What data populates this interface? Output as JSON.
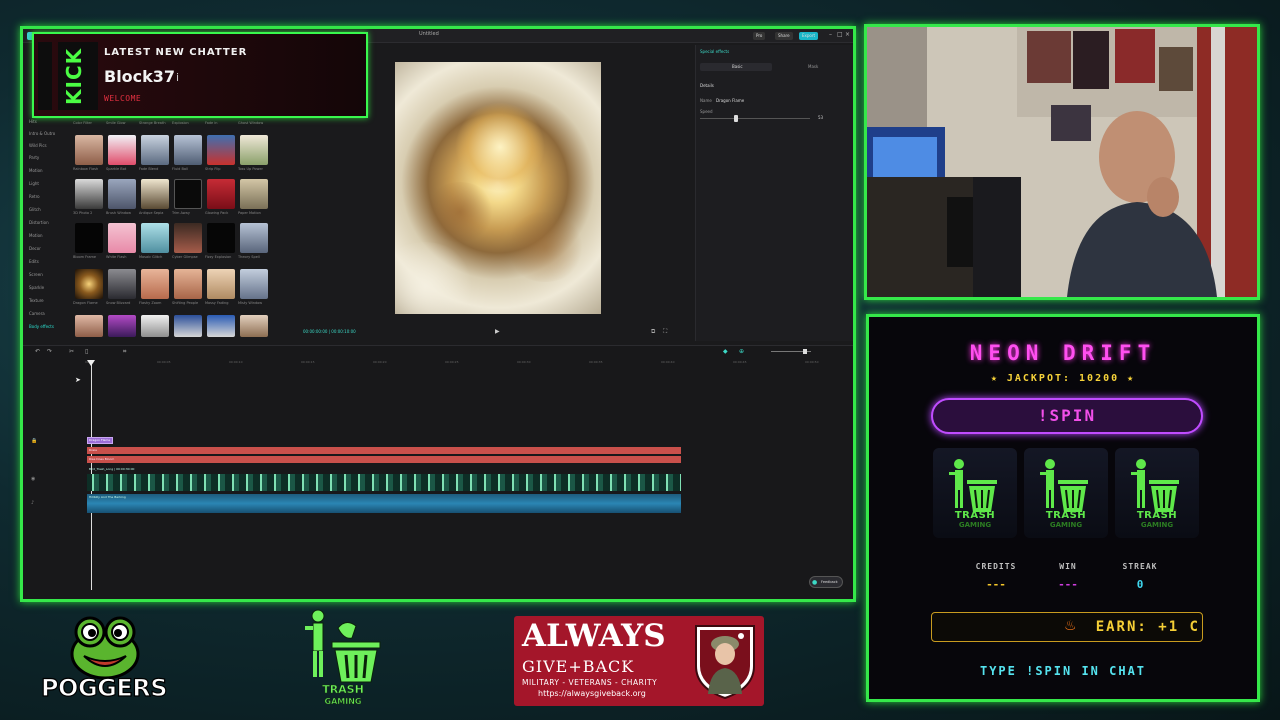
{
  "editor": {
    "window_title": "Untitled",
    "topbar_buttons": [
      "Pro",
      "Share",
      "Export"
    ],
    "categories": [
      "Hits",
      "Intro & Outro",
      "Wild Pics",
      "Party",
      "Motion",
      "Light",
      "Retro",
      "Glitch",
      "Distortion",
      "Motion",
      "Decor",
      "Edits",
      "Screen",
      "Sparkle",
      "Texture",
      "Camera",
      "Body effects"
    ],
    "thumb_labels": [
      [
        "Color Filter",
        "Smile Glow",
        "Strange Breath",
        "Explosion",
        "Fade in",
        "Ghost Window"
      ],
      [
        "Rainbow Flash",
        "Sparkle Bot",
        "Fade Blend",
        "Fluid Ball",
        "Strip Flip",
        "Toss Up Power"
      ],
      [
        "3D Photo 2",
        "Brush Window",
        "Antique Sepia",
        "Trim Away",
        "Glowing Pack",
        "Paper Motion"
      ],
      [
        "Bloom Frame",
        "White Flash",
        "Mosaic Glitch",
        "Cyber Glimpse",
        "Fizzy Explosion",
        "Theory Spell"
      ],
      [
        "Dragon Flame",
        "Snow Blizzard",
        "Flashy Zoom",
        "Shifting People",
        "Mossy Fading",
        "Misty Window"
      ]
    ],
    "preview_time": "00:00:00:00 | 00:00:10:00",
    "right_panel": {
      "header": "Special effects",
      "tabs": [
        "Basic",
        "Mask"
      ],
      "section": "Details",
      "name_label": "Name",
      "name_value": "Dragon Flame",
      "speed_label": "Speed",
      "speed_value": "53"
    },
    "ruler_ticks": [
      "00:00",
      "00:00:05",
      "00:00:10",
      "00:00:15",
      "00:00:20",
      "00:00:25",
      "00:00:30",
      "00:00:35",
      "00:00:40",
      "00:00:45",
      "00:00:50"
    ],
    "tracks": {
      "effect_clip": "Dragon Flame",
      "text_clip_1": "Rosie",
      "text_clip_2": "Rise Does Bloom",
      "video_clip": "Bird_Trash_Long | 00:00:30:00",
      "audio_clip": "Hillbilly And The Barking"
    },
    "feedback_label": "Feedback"
  },
  "kick_popup": {
    "badge": "KICK",
    "heading": "LATEST NEW CHATTER",
    "username": "Block37",
    "cursor": "i",
    "welcome": "WELCOME"
  },
  "game": {
    "title": "NEON DRIFT",
    "jackpot": "★ JACKPOT: 10200 ★",
    "spin_button": "!SPIN",
    "reel_text": "TRASH",
    "reel_subtext": "GAMING",
    "stats": [
      {
        "label": "CREDITS",
        "value": "---",
        "color": "#f5c72a"
      },
      {
        "label": "WIN",
        "value": "---",
        "color": "#cf3ddf"
      },
      {
        "label": "STREAK",
        "value": "0",
        "color": "#3fd8f0"
      }
    ],
    "earn_icon": "fire-icon",
    "earn_text": "EARN: +1 C",
    "footer": "TYPE !SPIN IN CHAT"
  },
  "logos": {
    "poggers": "POGGERS",
    "trash_title": "TRASH",
    "trash_sub": "GAMING",
    "always_line1": "ALWAYS",
    "always_line2": "GIVE+BACK",
    "always_line3": "MILITARY - VETERANS - CHARITY",
    "always_url": "https://alwaysgiveback.org"
  },
  "colors": {
    "frame_green": "#35e84a",
    "neon_pink": "#ff4ff0",
    "gold": "#f5cf36",
    "cyan": "#55e3ef",
    "agb_red": "#a4162a"
  }
}
